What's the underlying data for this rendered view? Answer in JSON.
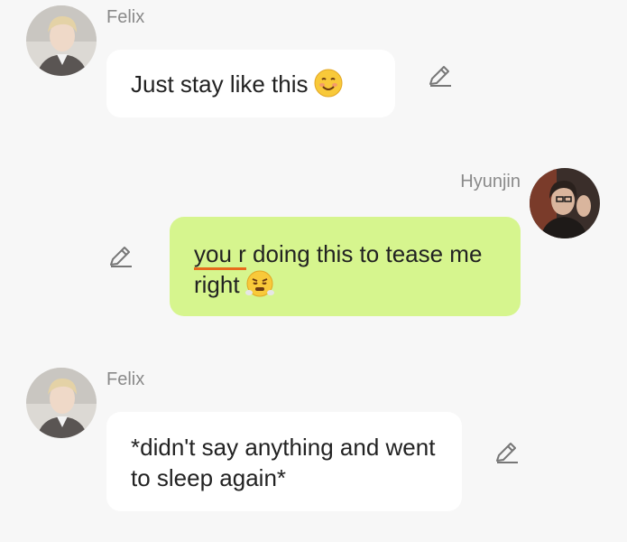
{
  "messages": [
    {
      "sender": "Felix",
      "text": "Just stay like this",
      "emoji": "smiling-face-emoji"
    },
    {
      "sender": "Hyunjin",
      "text_underlined": "you r",
      "text_rest": " doing this to tease me right",
      "emoji": "face-with-steam-emoji"
    },
    {
      "sender": "Felix",
      "text": "*didn't say anything and went to sleep again*"
    }
  ],
  "colors": {
    "background": "#f7f7f7",
    "incoming_bubble": "#ffffff",
    "outgoing_bubble": "#d6f58e",
    "sender_name": "#8a8a8a",
    "spellcheck_underline": "#e76b1c"
  },
  "icons": {
    "edit": "pencil-icon"
  }
}
